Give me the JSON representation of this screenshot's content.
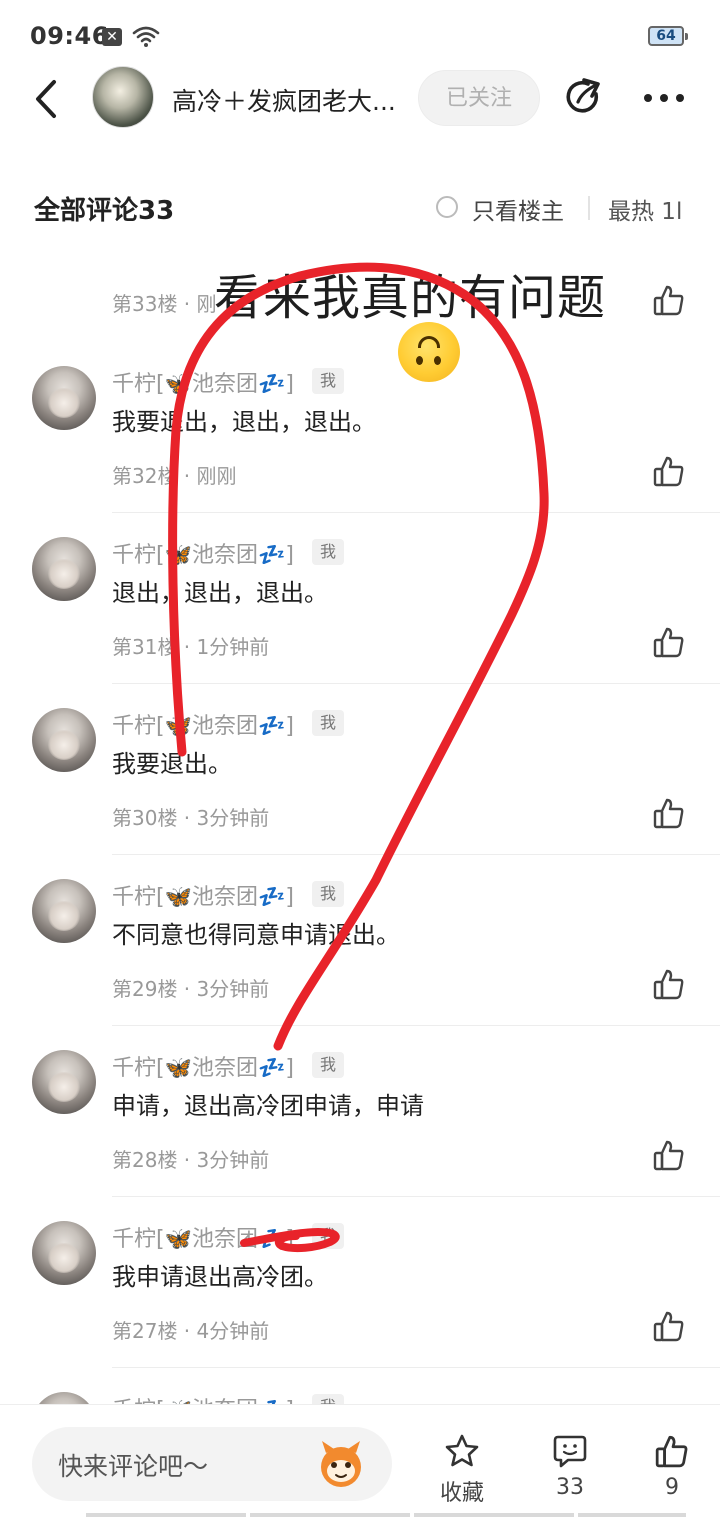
{
  "status_bar": {
    "time": "09:46",
    "battery": "64"
  },
  "header": {
    "group_name": "高冷＋发疯团老大...",
    "follow_label": "已关注"
  },
  "comments_bar": {
    "title": "全部评论33",
    "only_owner": "只看楼主",
    "sort": "最热 1l"
  },
  "partial_top": {
    "meta": "第33楼 · 刚"
  },
  "comments": [
    {
      "user": "千柠[🦋池奈团💤]",
      "badge": "我",
      "text": "我要退出，退出，退出。",
      "floor": "第32楼",
      "time": "刚刚"
    },
    {
      "user": "千柠[🦋池奈团💤]",
      "badge": "我",
      "text": "退出，退出，退出。",
      "floor": "第31楼",
      "time": "1分钟前"
    },
    {
      "user": "千柠[🦋池奈团💤]",
      "badge": "我",
      "text": "我要退出。",
      "floor": "第30楼",
      "time": "3分钟前"
    },
    {
      "user": "千柠[🦋池奈团💤]",
      "badge": "我",
      "text": "不同意也得同意申请退出。",
      "floor": "第29楼",
      "time": "3分钟前"
    },
    {
      "user": "千柠[🦋池奈团💤]",
      "badge": "我",
      "text": "申请，退出高冷团申请，申请",
      "floor": "第28楼",
      "time": "3分钟前"
    },
    {
      "user": "千柠[🦋池奈团💤]",
      "badge": "我",
      "text": "我申请退出高冷团。",
      "floor": "第27楼",
      "time": "4分钟前"
    },
    {
      "user": "千柠[🦋池奈团💤]",
      "badge": "我",
      "text": "",
      "floor": "",
      "time": ""
    }
  ],
  "annotation": {
    "text": "看来我真的有问题"
  },
  "bottom_bar": {
    "placeholder": "快来评论吧～",
    "favorite_label": "收藏",
    "comment_count": "33",
    "like_count": "9"
  },
  "colors": {
    "annotation_red": "#e8232a",
    "meta_gray": "#999999"
  }
}
